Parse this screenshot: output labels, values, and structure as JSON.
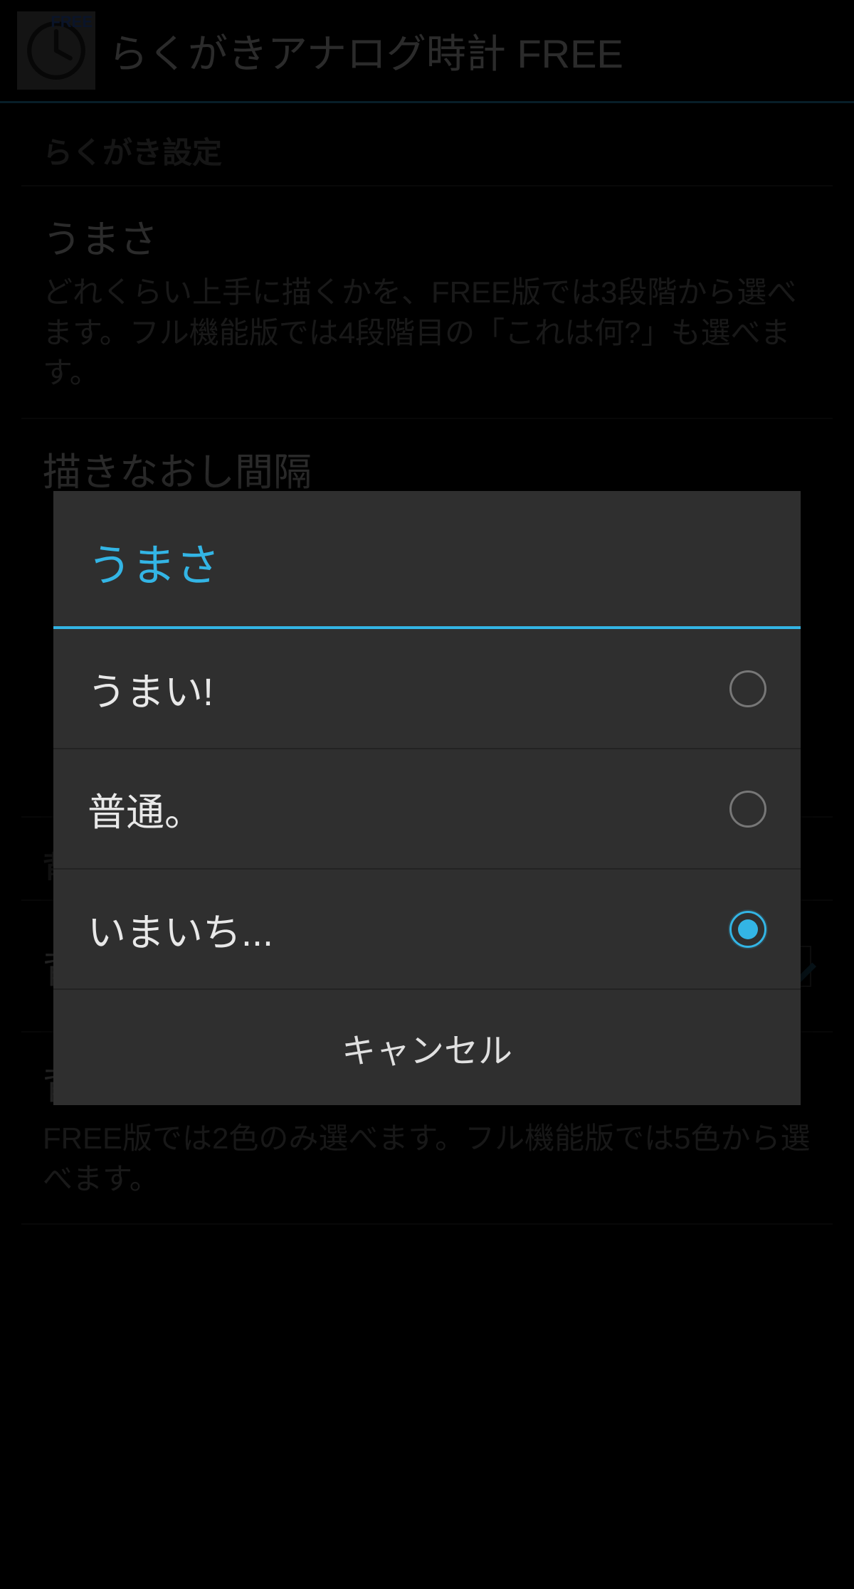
{
  "header": {
    "app_title": "らくがきアナログ時計 FREE",
    "icon_tag": "FREE"
  },
  "sections": {
    "doodle_header": "らくがき設定",
    "umasa_title": "うまさ",
    "umasa_desc": "どれくらい上手に描くかを、FREE版では3段階から選べます。フル機能版では4段階目の「これは何?」も選べます。",
    "interval_title": "描きなおし間隔",
    "bg_header": "背景の設定",
    "bg_draw_label": "背景を描く",
    "bg_color_title": "背景の色",
    "bg_color_desc": "FREE版では2色のみ選べます。フル機能版では5色から選べます。"
  },
  "dialog": {
    "title": "うまさ",
    "options": [
      {
        "label": "うまい!",
        "selected": false
      },
      {
        "label": "普通。",
        "selected": false
      },
      {
        "label": "いまいち...",
        "selected": true
      }
    ],
    "cancel": "キャンセル"
  }
}
